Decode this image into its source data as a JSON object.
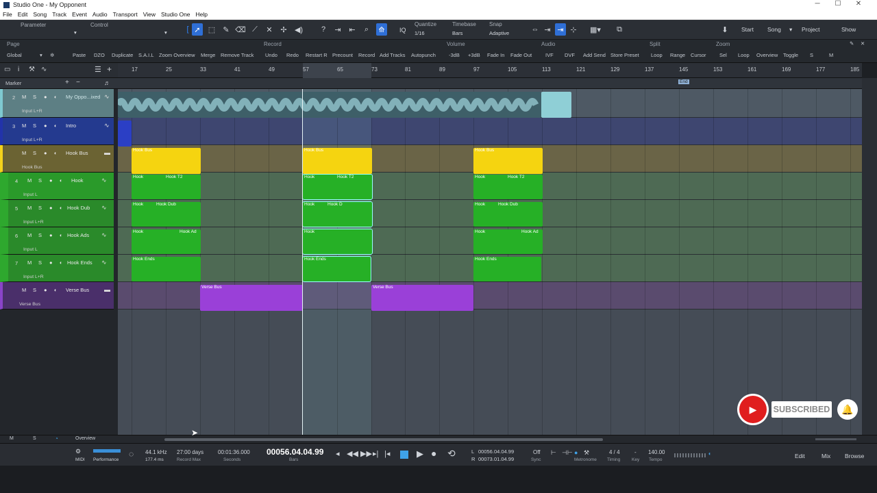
{
  "window": {
    "title": "Studio One - My Opponent"
  },
  "menu": [
    "File",
    "Edit",
    "Song",
    "Track",
    "Event",
    "Audio",
    "Transport",
    "View",
    "Studio One",
    "Help"
  ],
  "toolbar": {
    "parameter_label": "Parameter",
    "control_label": "Control",
    "quantize_label": "Quantize",
    "quantize_value": "1/16",
    "timebase_label": "Timebase",
    "timebase_value": "Bars",
    "snap_label": "Snap",
    "snap_value": "Adaptive",
    "iq_label": "IQ",
    "nav": {
      "start": "Start",
      "song": "Song",
      "project": "Project",
      "show": "Show"
    }
  },
  "macro": {
    "sections": {
      "page": "Page",
      "record": "Record",
      "volume": "Volume",
      "audio": "Audio",
      "split": "Split",
      "zoom": "Zoom"
    },
    "global": "Global",
    "buttons": [
      "Paste",
      "DZO",
      "Duplicate",
      "S.A.I.L",
      "Zoom Overview",
      "Merge",
      "Remove Track",
      "Undo",
      "Redo",
      "Restart R",
      "Precount",
      "Record",
      "Add Tracks",
      "Autopunch",
      "-3dB",
      "+3dB",
      "Fade In",
      "Fade Out",
      "IVF",
      "DVF",
      "Add Send",
      "Store Preset",
      "Loop",
      "Range",
      "Cursor",
      "Sel",
      "Loop",
      "Overview",
      "Toggle",
      "S",
      "M"
    ]
  },
  "ruler": {
    "bars": [
      "17",
      "25",
      "33",
      "41",
      "49",
      "57",
      "65",
      "73",
      "81",
      "89",
      "97",
      "105",
      "113",
      "121",
      "129",
      "137",
      "145",
      "153",
      "161",
      "169",
      "177",
      "185"
    ],
    "end_marker": "End"
  },
  "marker_label": "Marker",
  "tracks": [
    {
      "num": "2",
      "name": "My Oppo...ixed",
      "input": "Input L+R",
      "color": "#7fc9d1"
    },
    {
      "num": "3",
      "name": "Intro",
      "input": "Input L+R",
      "color": "#2233aa"
    },
    {
      "num": "",
      "name": "Hook Bus",
      "input": "Hook Bus",
      "color": "#f4d21c"
    },
    {
      "num": "4",
      "name": "Hook",
      "input": "Input L",
      "color": "#2ea82e"
    },
    {
      "num": "5",
      "name": "Hook Dub",
      "input": "Input L+R",
      "color": "#2ea82e"
    },
    {
      "num": "6",
      "name": "Hook Ads",
      "input": "Input L",
      "color": "#2ea82e"
    },
    {
      "num": "7",
      "name": "Hook Ends",
      "input": "Input L+R",
      "color": "#2ea82e"
    },
    {
      "num": "",
      "name": "Verse Bus",
      "input": "Verse Bus",
      "color": "#8a44c9"
    }
  ],
  "mute_label": "M",
  "solo_label": "S",
  "events": {
    "hook_bus": "Hook Bus",
    "hook": "Hook",
    "hook_t2": "Hook T2",
    "hook_dub": "Hook Dub",
    "hook_short": "Hook",
    "hook_ads": "Hook Ad",
    "hook_ends": "Hook Ends",
    "verse_bus": "Verse Bus",
    "hook_d": "Hook D"
  },
  "scrollbar": {
    "overview": "Overview",
    "m": "M",
    "s": "S"
  },
  "transport": {
    "midi": "MIDI",
    "performance": "Performance",
    "sample_rate": "44.1 kHz",
    "latency": "177.4 ms",
    "record_max_value": "27:00 days",
    "record_max_label": "Record Max",
    "seconds_value": "00:01:36.000",
    "seconds_label": "Seconds",
    "bars_value": "00056.04.04.99",
    "bars_label": "Bars",
    "loop_l": "00056.04.04.99",
    "loop_r": "00073.01.04.99",
    "l": "L",
    "r": "R",
    "sync_value": "Off",
    "sync_label": "Sync",
    "metronome_label": "Metronome",
    "timing_value": "4 / 4",
    "timing_label": "Timing",
    "key_value": "-",
    "key_label": "Key",
    "tempo_value": "140.00",
    "tempo_label": "Tempo",
    "edit": "Edit",
    "mix": "Mix",
    "browse": "Browse"
  },
  "overlay": {
    "subscribed": "SUBSCRIBED"
  }
}
